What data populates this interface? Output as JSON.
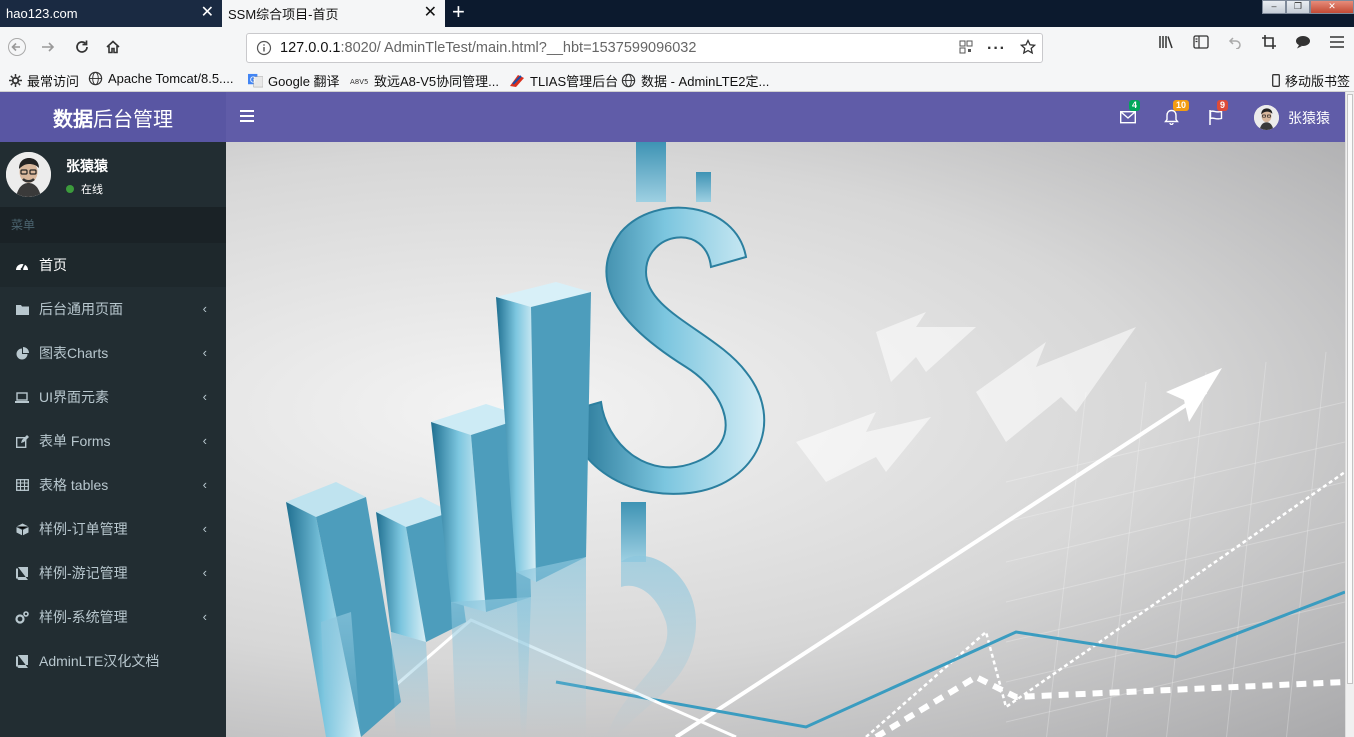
{
  "browser": {
    "tabs": [
      {
        "title": "hao123.com"
      },
      {
        "title": "SSM综合项目-首页"
      }
    ],
    "url": {
      "host": "127.0.0.1",
      "path": ":8020/ AdminTleTest/main.html?__hbt=1537599096032"
    },
    "bookmarks": [
      {
        "label": "最常访问",
        "icon": "gear-icon"
      },
      {
        "label": "Apache Tomcat/8.5....",
        "icon": "globe-icon"
      },
      {
        "label": "Google 翻译",
        "icon": "translate-icon"
      },
      {
        "label": "致远A8-V5协同管理...",
        "icon": "seeyon-icon"
      },
      {
        "label": "TLIAS管理后台",
        "icon": "tlias-icon"
      },
      {
        "label": "数据 - AdminLTE2定...",
        "icon": "globe-icon"
      }
    ],
    "mobile_bookmarks": "移动版书签"
  },
  "app": {
    "logo": {
      "bold": "数据",
      "rest": "后台管理"
    },
    "user": {
      "name": "张猿猿",
      "status": "在线"
    },
    "menu_header": "菜单",
    "menu": [
      {
        "label": "首页",
        "icon": "dashboard-icon",
        "has_children": false
      },
      {
        "label": "后台通用页面",
        "icon": "folder-icon",
        "has_children": true
      },
      {
        "label": "图表Charts",
        "icon": "pie-chart-icon",
        "has_children": true
      },
      {
        "label": "UI界面元素",
        "icon": "laptop-icon",
        "has_children": true
      },
      {
        "label": "表单 Forms",
        "icon": "edit-icon",
        "has_children": true
      },
      {
        "label": "表格 tables",
        "icon": "table-icon",
        "has_children": true
      },
      {
        "label": "样例-订单管理",
        "icon": "cube-icon",
        "has_children": true
      },
      {
        "label": "样例-游记管理",
        "icon": "book-icon",
        "has_children": true
      },
      {
        "label": "样例-系统管理",
        "icon": "cogs-icon",
        "has_children": true
      },
      {
        "label": "AdminLTE汉化文档",
        "icon": "book-icon",
        "has_children": false
      }
    ],
    "topbar": {
      "messages_count": "4",
      "notifications_count": "10",
      "tasks_count": "9",
      "user_name": "张猿猿"
    },
    "colors": {
      "header": "#605ca8",
      "logo": "#5956a3",
      "sidebar": "#222d32",
      "accent_teal": "#3a9cc0"
    }
  }
}
